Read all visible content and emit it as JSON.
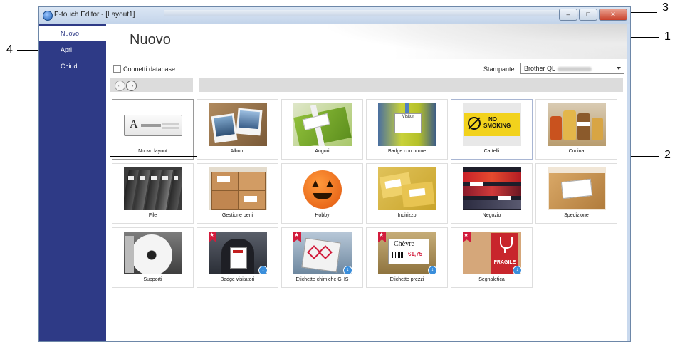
{
  "window": {
    "title": "P-touch Editor - [Layout1]",
    "controls": {
      "minimize": "–",
      "maximize": "□",
      "close": "✕"
    }
  },
  "sidebar": {
    "items": [
      {
        "label": "Nuovo",
        "active": true
      },
      {
        "label": "Apri",
        "active": false
      },
      {
        "label": "Chiudi",
        "active": false
      }
    ]
  },
  "main": {
    "title": "Nuovo",
    "connect_db_label": "Connetti database",
    "printer_label": "Stampante:",
    "printer_value": "Brother QL",
    "back_arrow": "←",
    "forward_arrow": "→"
  },
  "tiles": [
    {
      "label": "Nuovo layout",
      "icon": "new-layout-icon"
    },
    {
      "label": "Album",
      "icon": "album-photo"
    },
    {
      "label": "Auguri",
      "icon": "gift-photo"
    },
    {
      "label": "Badge con nome",
      "icon": "name-badge-photo"
    },
    {
      "label": "Cartelli",
      "icon": "no-smoking-sign-photo"
    },
    {
      "label": "Cucina",
      "icon": "kitchen-jars-photo"
    },
    {
      "label": "File",
      "icon": "binders-photo"
    },
    {
      "label": "Gestione beni",
      "icon": "boxes-photo"
    },
    {
      "label": "Hobby",
      "icon": "pumpkin-photo"
    },
    {
      "label": "Indirizzo",
      "icon": "envelopes-photo"
    },
    {
      "label": "Negozio",
      "icon": "shop-shelf-photo"
    },
    {
      "label": "Spedizione",
      "icon": "package-photo"
    },
    {
      "label": "Supporti",
      "icon": "disc-photo"
    },
    {
      "label": "Badge visitatori",
      "icon": "visitor-badge-photo"
    },
    {
      "label": "Etichette chimiche GHS",
      "icon": "ghs-label-photo"
    },
    {
      "label": "Etichette prezzi",
      "icon": "price-tag-photo"
    },
    {
      "label": "Segnaletica",
      "icon": "fragile-box-photo"
    }
  ],
  "tile_thumbs": {
    "new_layout_glyph": "A",
    "badge_text": "Visitor",
    "sign_text_1": "NO",
    "sign_text_2": "SMOKING",
    "price_text_1": "Chèvre",
    "price_text_2": "€1,75",
    "fragile_text": "FRAGILE"
  },
  "callouts": [
    "1",
    "2",
    "3",
    "4"
  ],
  "colors": {
    "sidebar": "#2e3a86",
    "badge_red": "#d21c3c",
    "download_blue": "#3a8edb"
  }
}
